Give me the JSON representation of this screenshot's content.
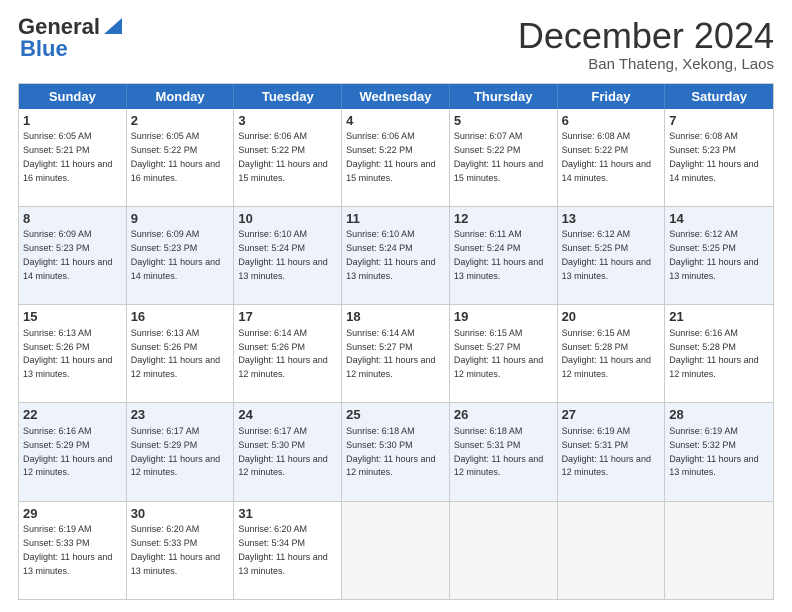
{
  "logo": {
    "line1": "General",
    "line2": "Blue"
  },
  "header": {
    "title": "December 2024",
    "subtitle": "Ban Thateng, Xekong, Laos"
  },
  "days": [
    "Sunday",
    "Monday",
    "Tuesday",
    "Wednesday",
    "Thursday",
    "Friday",
    "Saturday"
  ],
  "weeks": [
    [
      {
        "num": "1",
        "sunrise": "6:05 AM",
        "sunset": "5:21 PM",
        "daylight": "11 hours and 16 minutes."
      },
      {
        "num": "2",
        "sunrise": "6:05 AM",
        "sunset": "5:22 PM",
        "daylight": "11 hours and 16 minutes."
      },
      {
        "num": "3",
        "sunrise": "6:06 AM",
        "sunset": "5:22 PM",
        "daylight": "11 hours and 15 minutes."
      },
      {
        "num": "4",
        "sunrise": "6:06 AM",
        "sunset": "5:22 PM",
        "daylight": "11 hours and 15 minutes."
      },
      {
        "num": "5",
        "sunrise": "6:07 AM",
        "sunset": "5:22 PM",
        "daylight": "11 hours and 15 minutes."
      },
      {
        "num": "6",
        "sunrise": "6:08 AM",
        "sunset": "5:22 PM",
        "daylight": "11 hours and 14 minutes."
      },
      {
        "num": "7",
        "sunrise": "6:08 AM",
        "sunset": "5:23 PM",
        "daylight": "11 hours and 14 minutes."
      }
    ],
    [
      {
        "num": "8",
        "sunrise": "6:09 AM",
        "sunset": "5:23 PM",
        "daylight": "11 hours and 14 minutes."
      },
      {
        "num": "9",
        "sunrise": "6:09 AM",
        "sunset": "5:23 PM",
        "daylight": "11 hours and 14 minutes."
      },
      {
        "num": "10",
        "sunrise": "6:10 AM",
        "sunset": "5:24 PM",
        "daylight": "11 hours and 13 minutes."
      },
      {
        "num": "11",
        "sunrise": "6:10 AM",
        "sunset": "5:24 PM",
        "daylight": "11 hours and 13 minutes."
      },
      {
        "num": "12",
        "sunrise": "6:11 AM",
        "sunset": "5:24 PM",
        "daylight": "11 hours and 13 minutes."
      },
      {
        "num": "13",
        "sunrise": "6:12 AM",
        "sunset": "5:25 PM",
        "daylight": "11 hours and 13 minutes."
      },
      {
        "num": "14",
        "sunrise": "6:12 AM",
        "sunset": "5:25 PM",
        "daylight": "11 hours and 13 minutes."
      }
    ],
    [
      {
        "num": "15",
        "sunrise": "6:13 AM",
        "sunset": "5:26 PM",
        "daylight": "11 hours and 13 minutes."
      },
      {
        "num": "16",
        "sunrise": "6:13 AM",
        "sunset": "5:26 PM",
        "daylight": "11 hours and 12 minutes."
      },
      {
        "num": "17",
        "sunrise": "6:14 AM",
        "sunset": "5:26 PM",
        "daylight": "11 hours and 12 minutes."
      },
      {
        "num": "18",
        "sunrise": "6:14 AM",
        "sunset": "5:27 PM",
        "daylight": "11 hours and 12 minutes."
      },
      {
        "num": "19",
        "sunrise": "6:15 AM",
        "sunset": "5:27 PM",
        "daylight": "11 hours and 12 minutes."
      },
      {
        "num": "20",
        "sunrise": "6:15 AM",
        "sunset": "5:28 PM",
        "daylight": "11 hours and 12 minutes."
      },
      {
        "num": "21",
        "sunrise": "6:16 AM",
        "sunset": "5:28 PM",
        "daylight": "11 hours and 12 minutes."
      }
    ],
    [
      {
        "num": "22",
        "sunrise": "6:16 AM",
        "sunset": "5:29 PM",
        "daylight": "11 hours and 12 minutes."
      },
      {
        "num": "23",
        "sunrise": "6:17 AM",
        "sunset": "5:29 PM",
        "daylight": "11 hours and 12 minutes."
      },
      {
        "num": "24",
        "sunrise": "6:17 AM",
        "sunset": "5:30 PM",
        "daylight": "11 hours and 12 minutes."
      },
      {
        "num": "25",
        "sunrise": "6:18 AM",
        "sunset": "5:30 PM",
        "daylight": "11 hours and 12 minutes."
      },
      {
        "num": "26",
        "sunrise": "6:18 AM",
        "sunset": "5:31 PM",
        "daylight": "11 hours and 12 minutes."
      },
      {
        "num": "27",
        "sunrise": "6:19 AM",
        "sunset": "5:31 PM",
        "daylight": "11 hours and 12 minutes."
      },
      {
        "num": "28",
        "sunrise": "6:19 AM",
        "sunset": "5:32 PM",
        "daylight": "11 hours and 13 minutes."
      }
    ],
    [
      {
        "num": "29",
        "sunrise": "6:19 AM",
        "sunset": "5:33 PM",
        "daylight": "11 hours and 13 minutes."
      },
      {
        "num": "30",
        "sunrise": "6:20 AM",
        "sunset": "5:33 PM",
        "daylight": "11 hours and 13 minutes."
      },
      {
        "num": "31",
        "sunrise": "6:20 AM",
        "sunset": "5:34 PM",
        "daylight": "11 hours and 13 minutes."
      },
      null,
      null,
      null,
      null
    ]
  ]
}
